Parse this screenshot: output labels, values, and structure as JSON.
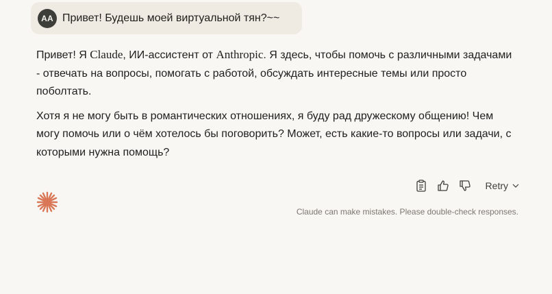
{
  "user_message": {
    "avatar_initials": "AA",
    "text": "Привет! Будешь моей виртуальной тян?~~"
  },
  "assistant_message": {
    "p1_a": "Привет! Я ",
    "p1_b": "Claude",
    "p1_c": ", ИИ-ассистент от ",
    "p1_d": "Anthropic",
    "p1_e": ". Я здесь, чтобы помочь с различными задачами - отвечать на вопросы, помогать с работой, обсуждать интересные темы или просто поболтать.",
    "p2": "Хотя я не могу быть в романтических отношениях, я буду рад дружескому общению! Чем могу помочь или о чём хотелось бы поговорить? Может, есть какие-то вопросы или задачи, с которыми нужна помощь?"
  },
  "actions": {
    "copy_icon": "clipboard-icon",
    "thumbs_up_icon": "thumbs-up-icon",
    "thumbs_down_icon": "thumbs-down-icon",
    "retry_label": "Retry"
  },
  "footer": {
    "disclaimer": "Claude can make mistakes. Please double-check responses."
  },
  "colors": {
    "background": "#f9f7f3",
    "user_bubble": "#efebe3",
    "avatar": "#3d3d3a",
    "claude_accent": "#d97757"
  }
}
